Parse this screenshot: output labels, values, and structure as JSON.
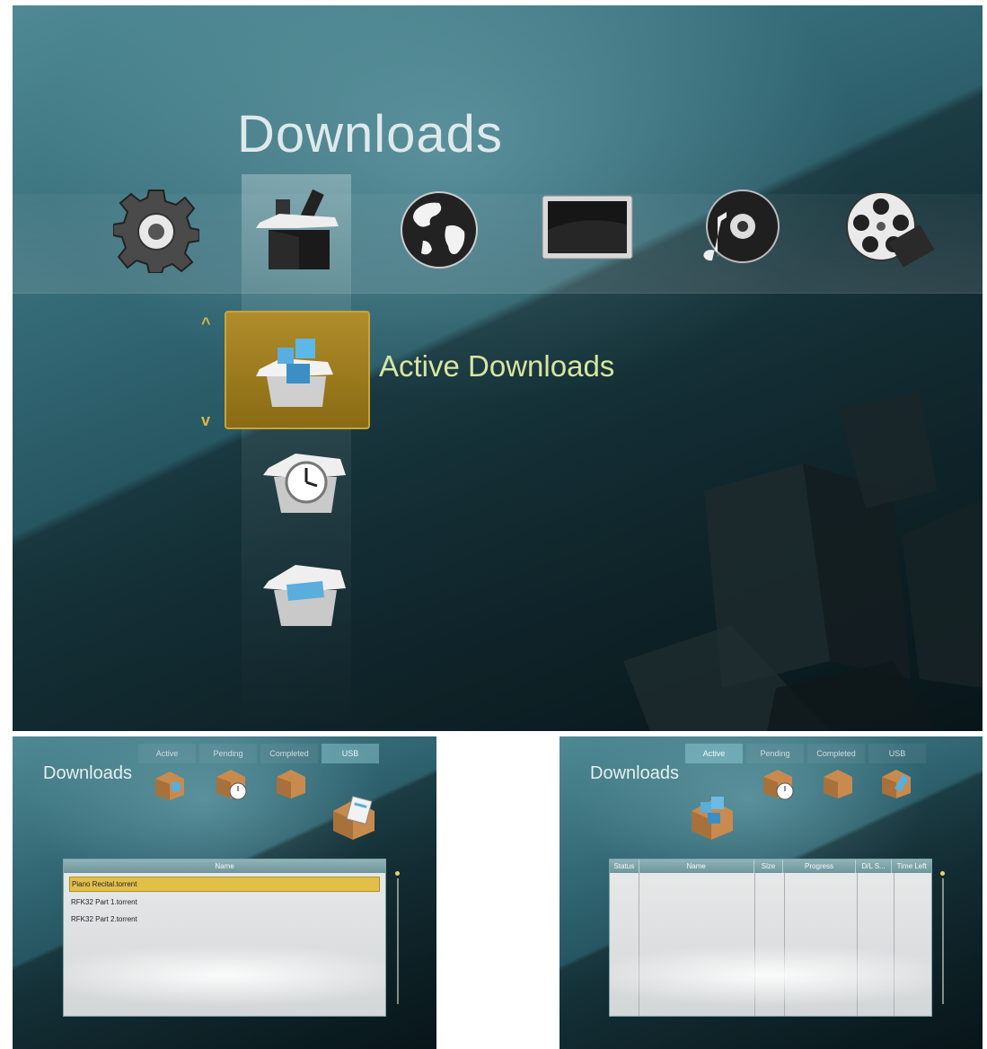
{
  "main": {
    "title": "Downloads",
    "categories": [
      {
        "icon": "settings-gear-icon"
      },
      {
        "icon": "downloads-box-icon",
        "selected": true
      },
      {
        "icon": "globe-icon"
      },
      {
        "icon": "tv-screen-icon"
      },
      {
        "icon": "music-disc-icon"
      },
      {
        "icon": "film-reel-icon"
      }
    ],
    "submenu": {
      "selected_label": "Active Downloads",
      "items": [
        {
          "icon": "active-downloads-box-icon"
        },
        {
          "icon": "pending-clock-box-icon"
        },
        {
          "icon": "completed-box-icon"
        }
      ]
    },
    "colors": {
      "accent": "#b08d2a",
      "label": "#d8e6a0",
      "background": "#2f6470"
    }
  },
  "usb_panel": {
    "title": "Downloads",
    "tabs": [
      {
        "label": "Active"
      },
      {
        "label": "Pending"
      },
      {
        "label": "Completed"
      },
      {
        "label": "USB",
        "selected": true
      }
    ],
    "list": {
      "header": "Name",
      "rows": [
        "Piano Recital.torrent",
        "RFK32 Part 1.torrent",
        "RFK32 Part 2.torrent"
      ],
      "selected_index": 0
    }
  },
  "active_panel": {
    "title": "Downloads",
    "tabs": [
      {
        "label": "Active",
        "selected": true
      },
      {
        "label": "Pending"
      },
      {
        "label": "Completed"
      },
      {
        "label": "USB"
      }
    ],
    "grid": {
      "columns": [
        "Status",
        "Name",
        "Size",
        "Progress",
        "D/L S...",
        "Time Left"
      ],
      "rows": []
    }
  }
}
